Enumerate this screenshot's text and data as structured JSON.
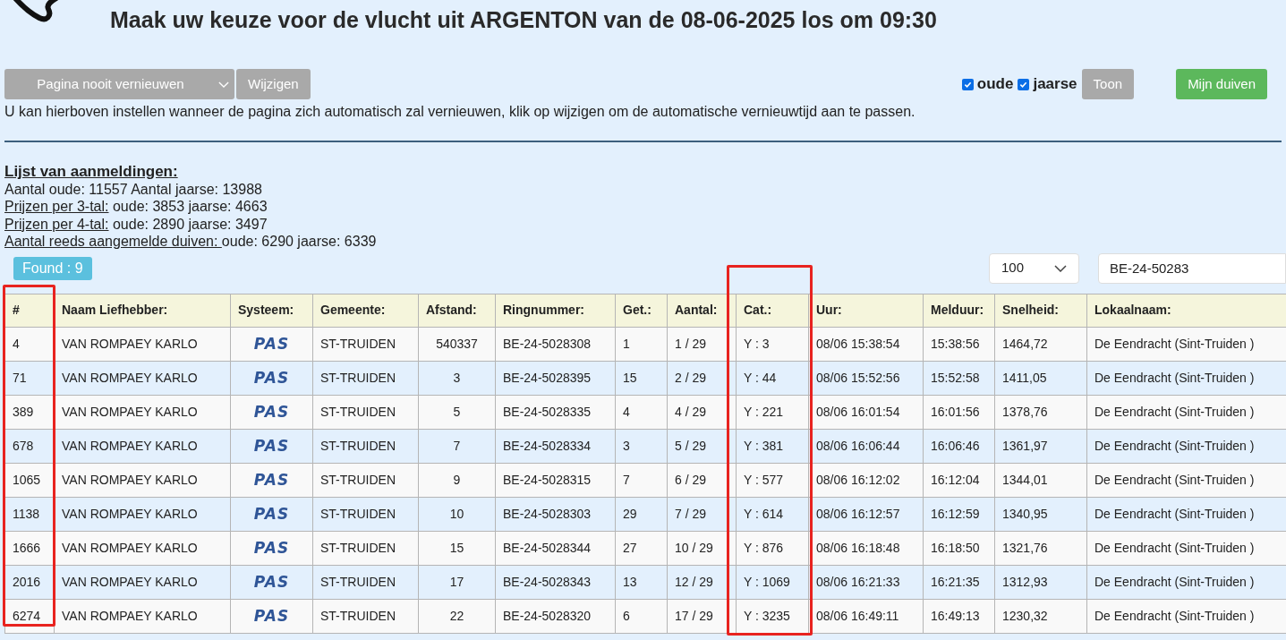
{
  "title": "Maak uw keuze voor de vlucht uit ARGENTON van de 08-06-2025 los om 09:30",
  "refresh": {
    "select_value": "Pagina nooit vernieuwen",
    "button": "Wijzigen"
  },
  "filters": [
    {
      "label": "oude",
      "checked": true
    },
    {
      "label": "jaarse",
      "checked": true
    }
  ],
  "show_button": "Toon",
  "my_pigeons_button": "Mijn duiven",
  "help_text": "U kan hierboven instellen wanneer de pagina zich automatisch zal vernieuwen, klik op wijzigen om de automatische vernieuwtijd aan te passen.",
  "list_heading": "Lijst van aanmeldingen:",
  "stats": [
    {
      "kind": "plain",
      "text": "Aantal oude: 11557 Aantal jaarse: 13988"
    },
    {
      "kind": "link",
      "link": "Prijzen per 3-tal:",
      "text": " oude: 3853 jaarse: 4663"
    },
    {
      "kind": "link",
      "link": "Prijzen per 4-tal:",
      "text": " oude: 2890 jaarse: 3497"
    },
    {
      "kind": "link",
      "link": "Aantal reeds aangemelde duiven: ",
      "text": "oude: 6290 jaarse: 6339"
    }
  ],
  "found_badge": "Found : 9",
  "page_size": "100",
  "search_value": "BE-24-50283",
  "table": {
    "columns": [
      "#",
      "Naam Liefhebber:",
      "Systeem:",
      "Gemeente:",
      "Afstand:",
      "Ringnummer:",
      "Get.:",
      "Aantal:",
      "Cat.:",
      "Uur:",
      "Melduur:",
      "Snelheid:",
      "Lokaalnaam:"
    ],
    "rows": [
      [
        "4",
        "VAN ROMPAEY KARLO",
        "PAS",
        "ST-TRUIDEN",
        "540337",
        "BE-24-5028308",
        "1",
        "1 / 29",
        "Y : 3",
        "08/06 15:38:54",
        "15:38:56",
        "1464,72",
        "De Eendracht (Sint-Truiden )"
      ],
      [
        "71",
        "VAN ROMPAEY KARLO",
        "PAS",
        "ST-TRUIDEN",
        "3",
        "BE-24-5028395",
        "15",
        "2 / 29",
        "Y : 44",
        "08/06 15:52:56",
        "15:52:58",
        "1411,05",
        "De Eendracht (Sint-Truiden )"
      ],
      [
        "389",
        "VAN ROMPAEY KARLO",
        "PAS",
        "ST-TRUIDEN",
        "5",
        "BE-24-5028335",
        "4",
        "4 / 29",
        "Y : 221",
        "08/06 16:01:54",
        "16:01:56",
        "1378,76",
        "De Eendracht (Sint-Truiden )"
      ],
      [
        "678",
        "VAN ROMPAEY KARLO",
        "PAS",
        "ST-TRUIDEN",
        "7",
        "BE-24-5028334",
        "3",
        "5 / 29",
        "Y : 381",
        "08/06 16:06:44",
        "16:06:46",
        "1361,97",
        "De Eendracht (Sint-Truiden )"
      ],
      [
        "1065",
        "VAN ROMPAEY KARLO",
        "PAS",
        "ST-TRUIDEN",
        "9",
        "BE-24-5028315",
        "7",
        "6 / 29",
        "Y : 577",
        "08/06 16:12:02",
        "16:12:04",
        "1344,01",
        "De Eendracht (Sint-Truiden )"
      ],
      [
        "1138",
        "VAN ROMPAEY KARLO",
        "PAS",
        "ST-TRUIDEN",
        "10",
        "BE-24-5028303",
        "29",
        "7 / 29",
        "Y : 614",
        "08/06 16:12:57",
        "16:12:59",
        "1340,95",
        "De Eendracht (Sint-Truiden )"
      ],
      [
        "1666",
        "VAN ROMPAEY KARLO",
        "PAS",
        "ST-TRUIDEN",
        "15",
        "BE-24-5028344",
        "27",
        "10 / 29",
        "Y : 876",
        "08/06 16:18:48",
        "16:18:50",
        "1321,76",
        "De Eendracht (Sint-Truiden )"
      ],
      [
        "2016",
        "VAN ROMPAEY KARLO",
        "PAS",
        "ST-TRUIDEN",
        "17",
        "BE-24-5028343",
        "13",
        "12 / 29",
        "Y : 1069",
        "08/06 16:21:33",
        "16:21:35",
        "1312,93",
        "De Eendracht (Sint-Truiden )"
      ],
      [
        "6274",
        "VAN ROMPAEY KARLO",
        "PAS",
        "ST-TRUIDEN",
        "22",
        "BE-24-5028320",
        "6",
        "17 / 29",
        "Y : 3235",
        "08/06 16:49:11",
        "16:49:13",
        "1230,32",
        "De Eendracht (Sint-Truiden )"
      ]
    ]
  }
}
